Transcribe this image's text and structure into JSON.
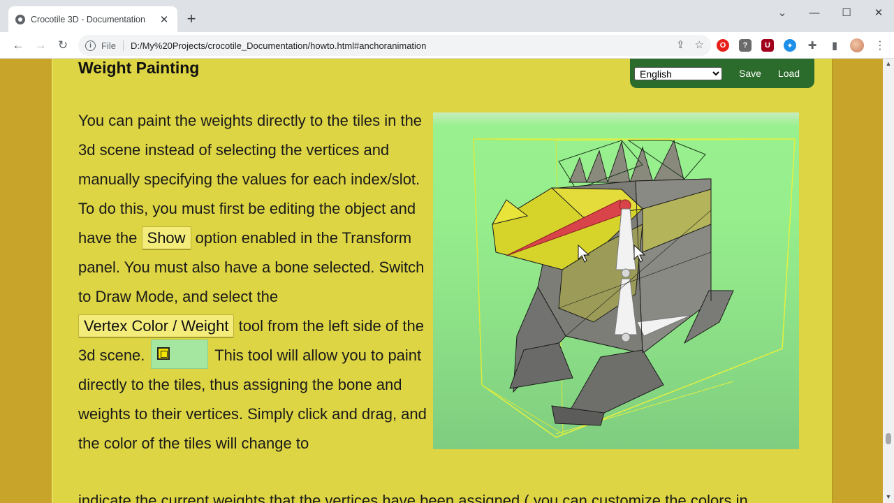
{
  "browser": {
    "tab_title": "Crocotile 3D - Documentation",
    "tab_close": "✕",
    "new_tab": "+",
    "window_controls": {
      "minimize": "—",
      "maximize": "☐",
      "close": "✕",
      "tab_search": "⌄"
    },
    "nav": {
      "back": "←",
      "forward": "→",
      "reload": "↻"
    },
    "scheme_label": "File",
    "url": "D:/My%20Projects/crocotile_Documentation/howto.html#anchoranimation",
    "omnibox_icons": {
      "share": "⇪",
      "bookmark": "☆"
    },
    "extensions": [
      {
        "name": "opera-icon",
        "glyph": "O",
        "color": "#e8201a"
      },
      {
        "name": "help-extension-icon",
        "glyph": "?",
        "color": "#6b6b6b"
      },
      {
        "name": "ublock-icon",
        "glyph": "U",
        "color": "#a0001c"
      },
      {
        "name": "bird-extension-icon",
        "glyph": "✦",
        "color": "#1d8fe8"
      }
    ],
    "puzzle_icon": "✚",
    "sidepanel_icon": "▮",
    "menu_icon": "⋮"
  },
  "page": {
    "heading": "Weight Painting",
    "language": {
      "selected": "English",
      "options": [
        "English"
      ]
    },
    "save_label": "Save",
    "load_label": "Load",
    "paragraph": {
      "p1": "You can paint the weights directly to the tiles in the 3d scene instead of selecting the vertices and manually specifying the values for each index/slot. To do this, you must first be editing the object and have the ",
      "chip_show": "Show",
      "p2": " option enabled in the Transform panel. You must also have a bone selected. Switch to Draw Mode, and select the ",
      "chip_vertex": "Vertex Color / Weight",
      "p3": " tool from the left side of the 3d scene. ",
      "p4": " This tool will allow you to paint directly to the tiles, thus assigning the bone and weights to their vertices. Simply click and drag, and the color of the tiles will change to"
    },
    "bottom_partial": "indicate the current weights that the vertices have been assigned ( you can customize the colors in"
  },
  "colors": {
    "page_bg": "#ddd543",
    "outer_bg": "#c8a52a",
    "lang_bar": "#2b6b2b",
    "scene_bg": "#96ee8c",
    "bone_red": "#d9434a"
  }
}
